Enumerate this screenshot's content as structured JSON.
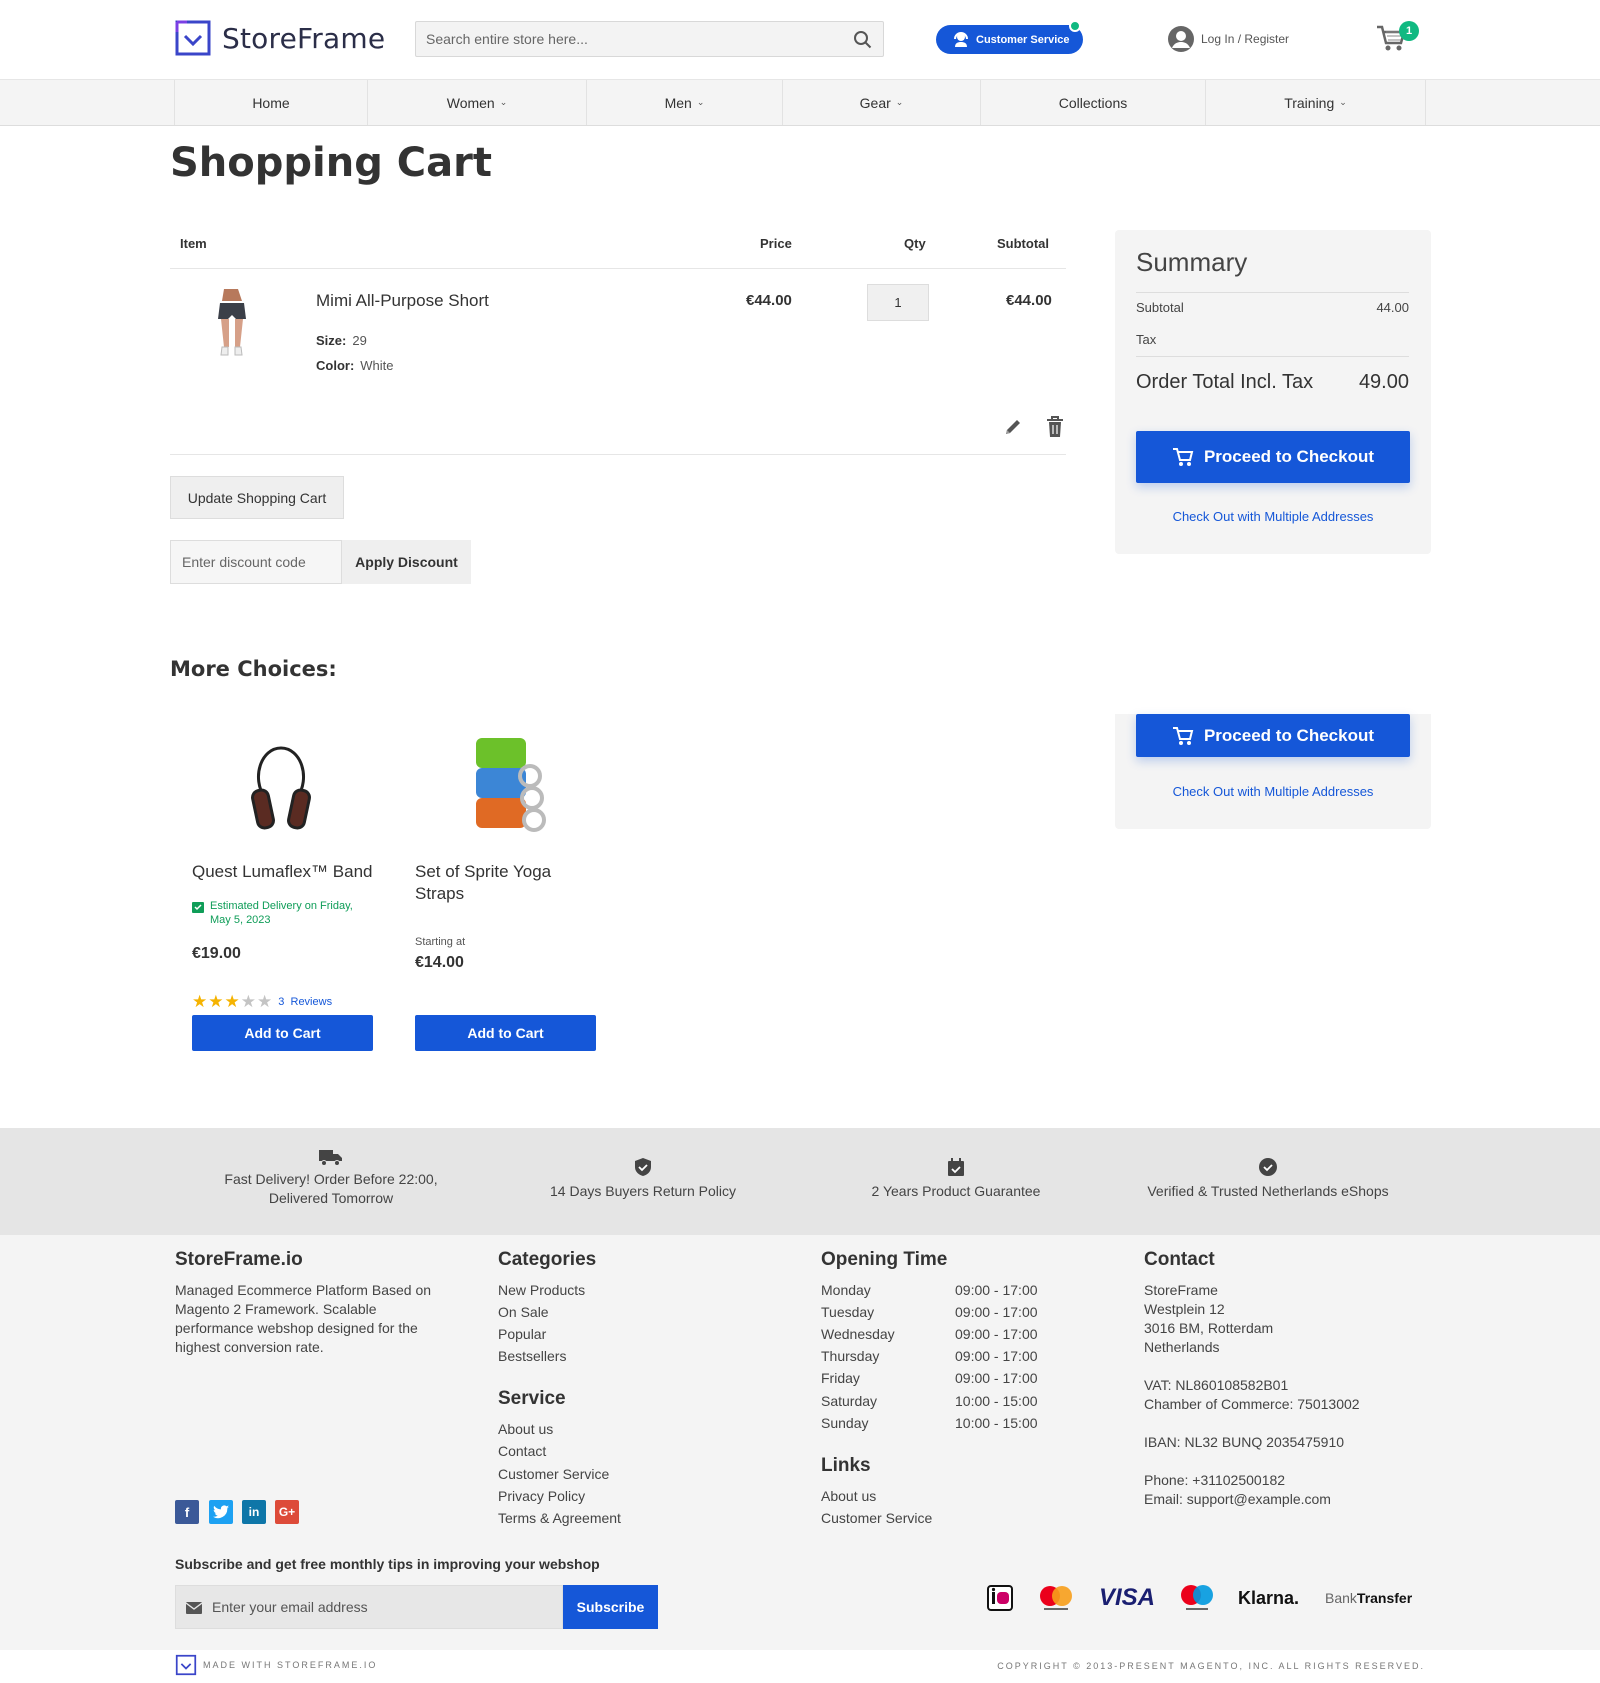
{
  "header": {
    "logo_text": "StoreFrame",
    "search_placeholder": "Search entire store here...",
    "customer_service": "Customer Service",
    "login": "Log In / Register",
    "cart_count": "1"
  },
  "nav": {
    "items": [
      {
        "label": "Home",
        "dropdown": false
      },
      {
        "label": "Women",
        "dropdown": true
      },
      {
        "label": "Men",
        "dropdown": true
      },
      {
        "label": "Gear",
        "dropdown": true
      },
      {
        "label": "Collections",
        "dropdown": false
      },
      {
        "label": "Training",
        "dropdown": true
      }
    ]
  },
  "page_title": "Shopping Cart",
  "cart": {
    "columns": {
      "item": "Item",
      "price": "Price",
      "qty": "Qty",
      "subtotal": "Subtotal"
    },
    "items": [
      {
        "name": "Mimi All-Purpose Short",
        "size_label": "Size:",
        "size": "29",
        "color_label": "Color:",
        "color": "White",
        "price": "€44.00",
        "qty": "1",
        "subtotal": "€44.00"
      }
    ],
    "update_label": "Update Shopping Cart",
    "discount_placeholder": "Enter discount code",
    "apply_label": "Apply Discount"
  },
  "summary": {
    "title": "Summary",
    "subtotal_label": "Subtotal",
    "subtotal_value": "44.00",
    "tax_label": "Tax",
    "total_label": "Order Total Incl. Tax",
    "total_value": "49.00",
    "checkout_label": "Proceed to Checkout",
    "multi_label": "Check Out with Multiple Addresses"
  },
  "more_choices": {
    "title": "More Choices:",
    "products": [
      {
        "name": "Quest Lumaflex™ Band",
        "delivery": "Estimated Delivery on Friday, May 5, 2023",
        "price": "€19.00",
        "rating": 3,
        "reviews_count": "3",
        "reviews_label": "Reviews",
        "button": "Add to Cart"
      },
      {
        "name": "Set of Sprite Yoga Straps",
        "starting_label": "Starting at",
        "price": "€14.00",
        "button": "Add to Cart"
      }
    ]
  },
  "usp": [
    {
      "icon": "truck-icon",
      "text": "Fast Delivery! Order Before 22:00, Delivered Tomorrow"
    },
    {
      "icon": "shield-check-icon",
      "text": "14 Days Buyers Return Policy"
    },
    {
      "icon": "calendar-check-icon",
      "text": "2 Years Product Guarantee"
    },
    {
      "icon": "check-circle-icon",
      "text": "Verified & Trusted Netherlands eShops"
    }
  ],
  "footer": {
    "about": {
      "title": "StoreFrame.io",
      "text": "Managed Ecommerce Platform Based on Magento 2 Framework. Scalable performance webshop designed for the highest conversion rate."
    },
    "categories": {
      "title": "Categories",
      "links": [
        "New Products",
        "On Sale",
        "Popular",
        "Bestsellers"
      ]
    },
    "service": {
      "title": "Service",
      "links": [
        "About us",
        "Contact",
        "Customer Service",
        "Privacy Policy",
        "Terms & Agreement"
      ]
    },
    "opening": {
      "title": "Opening Time",
      "rows": [
        {
          "day": "Monday",
          "hours": "09:00 - 17:00"
        },
        {
          "day": "Tuesday",
          "hours": "09:00 - 17:00"
        },
        {
          "day": "Wednesday",
          "hours": "09:00 - 17:00"
        },
        {
          "day": "Thursday",
          "hours": "09:00 - 17:00"
        },
        {
          "day": "Friday",
          "hours": "09:00 - 17:00"
        },
        {
          "day": "Saturday",
          "hours": "10:00 - 15:00"
        },
        {
          "day": "Sunday",
          "hours": "10:00 - 15:00"
        }
      ]
    },
    "links": {
      "title": "Links",
      "links": [
        "About us",
        "Customer Service"
      ]
    },
    "contact": {
      "title": "Contact",
      "lines": [
        "StoreFrame",
        "Westplein 12",
        "3016 BM, Rotterdam",
        "Netherlands",
        "",
        "VAT: NL860108582B01",
        "Chamber of Commerce: 75013002",
        "",
        "IBAN: NL32 BUNQ 2035475910",
        "",
        "Phone: +31102500182",
        "Email: support@example.com"
      ]
    },
    "social": [
      "facebook-icon",
      "twitter-icon",
      "linkedin-icon",
      "google-plus-icon"
    ],
    "subscribe_label": "Subscribe and get free monthly tips in improving your webshop",
    "email_placeholder": "Enter your email address",
    "subscribe_button": "Subscribe",
    "payments": [
      "ideal-icon",
      "mastercard-icon",
      "visa-icon",
      "maestro-icon",
      "klarna-icon",
      "bank-transfer-icon"
    ],
    "visa_text": "VISA",
    "klarna_text": "Klarna.",
    "bank_text_a": "Bank",
    "bank_text_b": "Transfer"
  },
  "bottom": {
    "made_with": "MADE WITH STOREFRAME.IO",
    "copyright": "COPYRIGHT © 2013-PRESENT MAGENTO, INC. ALL RIGHTS RESERVED."
  },
  "colors": {
    "accent": "#1557d8",
    "green": "#10b981",
    "logo": "#2b2e48"
  }
}
